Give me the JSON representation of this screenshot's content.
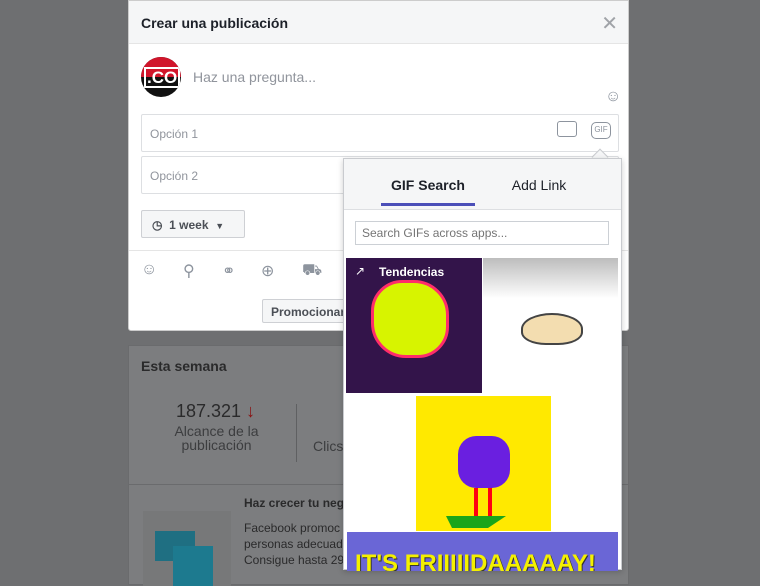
{
  "modal": {
    "title": "Crear una publicación",
    "placeholder": "Haz una pregunta...",
    "avatar_text": ".CO",
    "options": [
      "Opción 1",
      "Opción 2"
    ],
    "duration": "1 week",
    "promote_label": "Promocionar"
  },
  "gif_popover": {
    "tabs": [
      {
        "label": "GIF Search",
        "active": true
      },
      {
        "label": "Add Link",
        "active": false
      }
    ],
    "search_placeholder": "Search GIFs across apps...",
    "trending_label": "Tendencias",
    "banner_text": "IT'S FRIIIIIDAAAAAY!",
    "accent": "#4b4fb8"
  },
  "background": {
    "section_title": "Esta semana",
    "metric_value": "187.321",
    "metric_label": "Alcance de la publicación",
    "metric2_label": "Clics",
    "promo_title": "Haz crecer tu neg",
    "promo_lines": [
      "Facebook promoc",
      "personas adecuad",
      "Consigue hasta 29"
    ]
  }
}
